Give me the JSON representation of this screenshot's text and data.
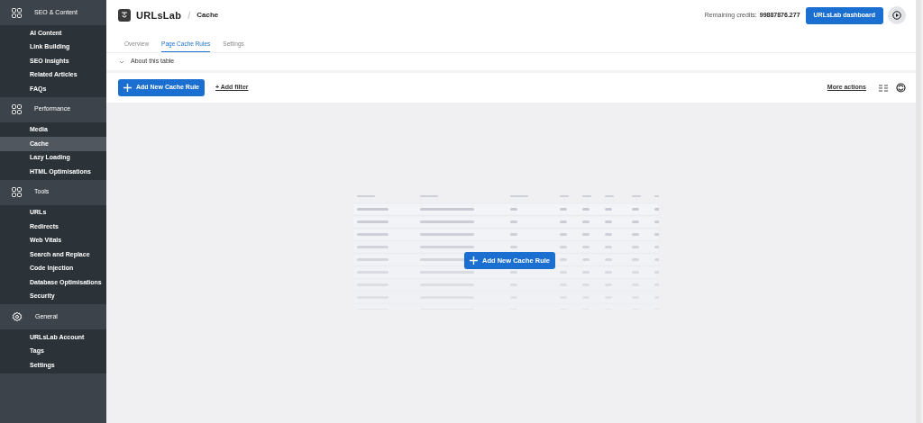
{
  "sidebar": {
    "sections": [
      {
        "title": "SEO & Content",
        "items": [
          {
            "label": "AI Content",
            "selected": false
          },
          {
            "label": "Link Building",
            "selected": false
          },
          {
            "label": "SEO Insights",
            "selected": false
          },
          {
            "label": "Related Articles",
            "selected": false
          },
          {
            "label": "FAQs",
            "selected": false
          }
        ]
      },
      {
        "title": "Performance",
        "items": [
          {
            "label": "Media",
            "selected": false
          },
          {
            "label": "Cache",
            "selected": true
          },
          {
            "label": "Lazy Loading",
            "selected": false
          },
          {
            "label": "HTML Optimisations",
            "selected": false
          }
        ]
      },
      {
        "title": "Tools",
        "items": [
          {
            "label": "URLs",
            "selected": false
          },
          {
            "label": "Redirects",
            "selected": false
          },
          {
            "label": "Web Vitals",
            "selected": false
          },
          {
            "label": "Search and Replace",
            "selected": false
          },
          {
            "label": "Code Injection",
            "selected": false
          },
          {
            "label": "Database Optimisations",
            "selected": false
          },
          {
            "label": "Security",
            "selected": false
          }
        ]
      },
      {
        "title": "General",
        "items": [
          {
            "label": "URLsLab Account",
            "selected": false
          },
          {
            "label": "Tags",
            "selected": false
          },
          {
            "label": "Settings",
            "selected": false
          }
        ]
      }
    ]
  },
  "header": {
    "brand": "URLsLab",
    "separator": "/",
    "page": "Cache",
    "credits_label": "Remaining credits:",
    "credits_value": "99887876.277",
    "dashboard_button": "URLsLab dashboard"
  },
  "tabs": [
    {
      "label": "Overview",
      "selected": false
    },
    {
      "label": "Page Cache Rules",
      "selected": true
    },
    {
      "label": "Settings",
      "selected": false
    }
  ],
  "about": {
    "label": "About this table",
    "expanded": false
  },
  "toolbar": {
    "add_button": "Add New Cache Rule",
    "add_filter": "+ Add filter",
    "more_actions": "More actions"
  },
  "empty_state": {
    "button": "Add New Cache Rule"
  }
}
